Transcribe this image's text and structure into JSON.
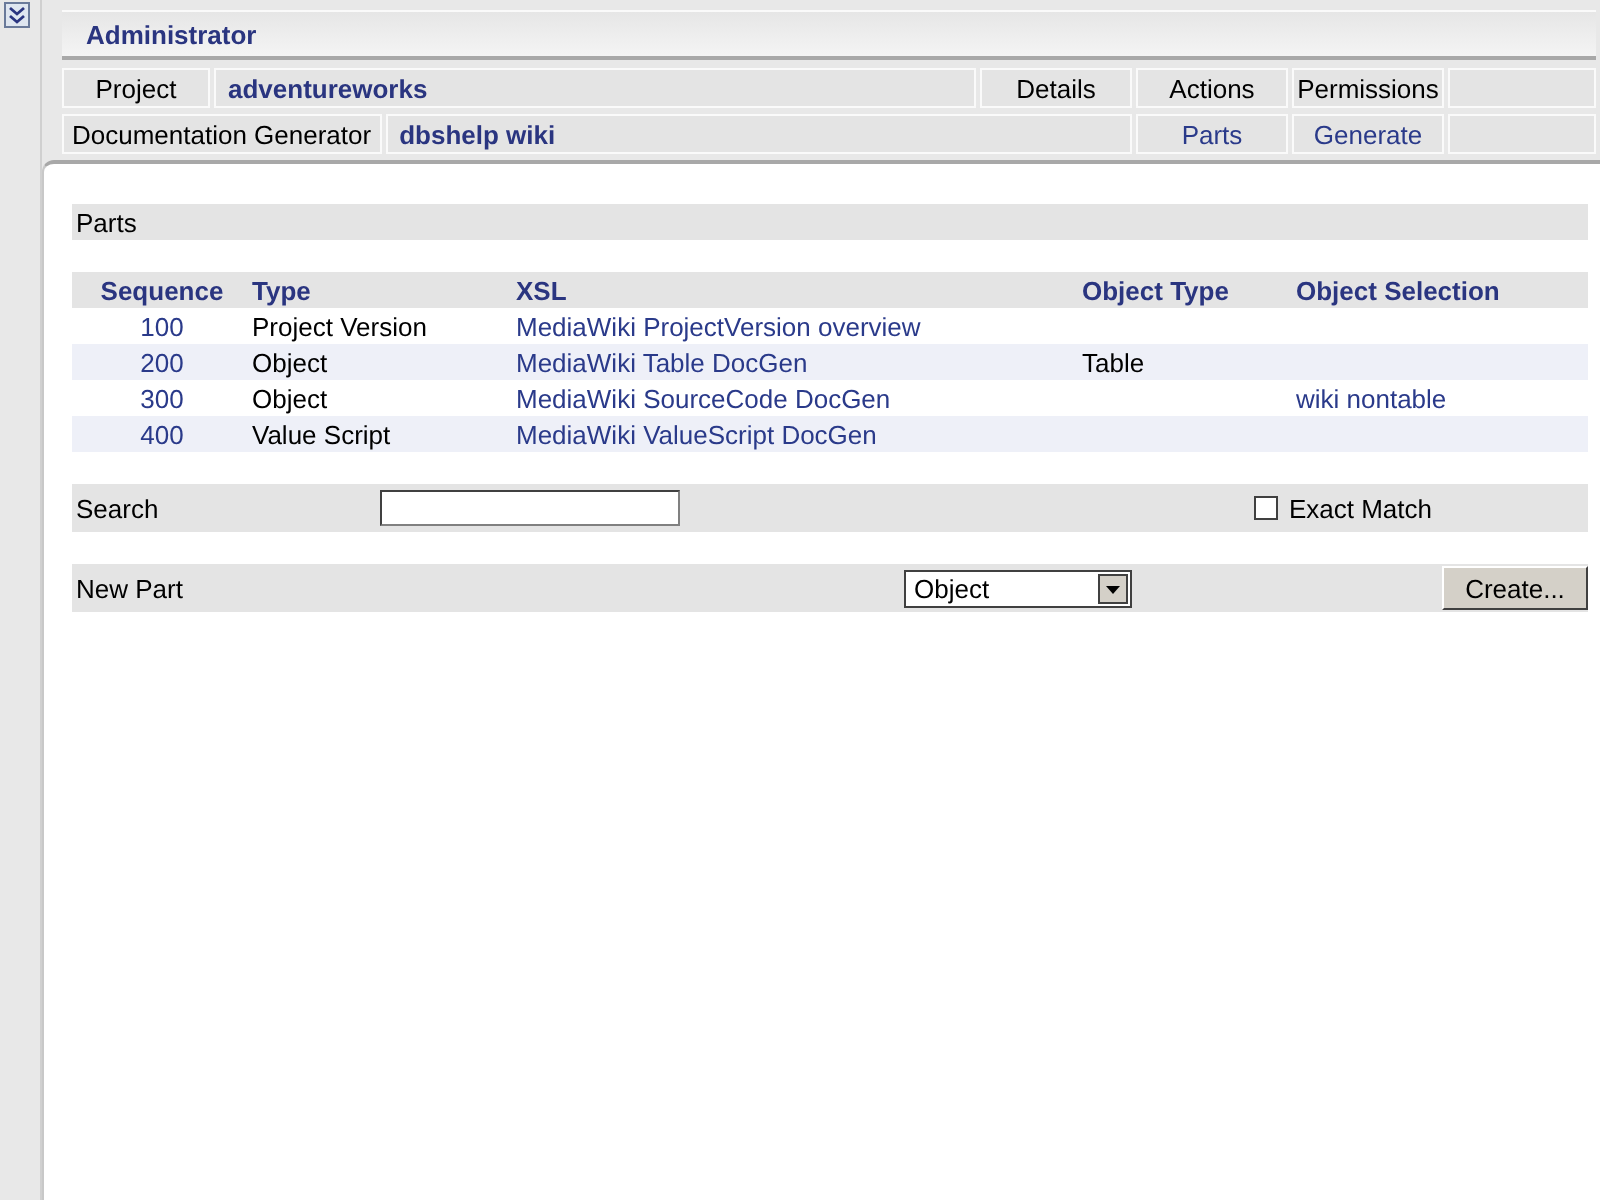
{
  "header": {
    "title": "Administrator"
  },
  "context_rows": [
    {
      "label": "Project",
      "value": "adventureworks",
      "actions": [
        "Details",
        "Actions",
        "Permissions"
      ],
      "kind": "plain"
    },
    {
      "label": "Documentation Generator",
      "value": "dbshelp wiki",
      "actions": [
        "Parts",
        "Generate"
      ],
      "kind": "link"
    }
  ],
  "section": {
    "title": "Parts"
  },
  "table": {
    "columns": [
      "Sequence",
      "Type",
      "XSL",
      "Object Type",
      "Object Selection"
    ],
    "rows": [
      [
        "100",
        "Project Version",
        "MediaWiki ProjectVersion overview",
        "",
        ""
      ],
      [
        "200",
        "Object",
        "MediaWiki Table DocGen",
        "Table",
        ""
      ],
      [
        "300",
        "Object",
        "MediaWiki SourceCode DocGen",
        "",
        "wiki nontable"
      ],
      [
        "400",
        "Value Script",
        "MediaWiki ValueScript DocGen",
        "",
        ""
      ]
    ]
  },
  "search": {
    "label": "Search",
    "exact_match": {
      "label": "Exact Match",
      "checked": false
    }
  },
  "new_part": {
    "label": "New Part",
    "type_value": "Object",
    "create_button": "Create..."
  }
}
